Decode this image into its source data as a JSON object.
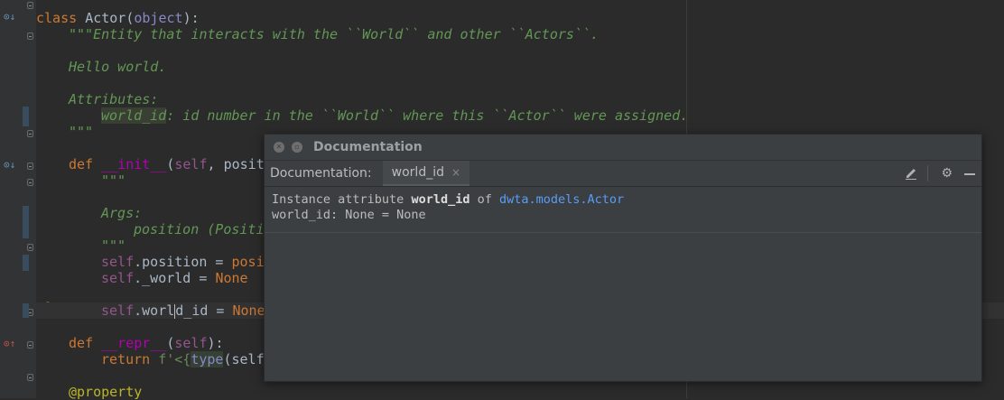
{
  "code": {
    "l1": {
      "kw": "class ",
      "name": "Actor(",
      "base": "object",
      "rest": "):"
    },
    "l2": "\"\"\"Entity that interacts with the ``World`` and other ``Actors``.",
    "l3": "Hello world.",
    "l4": "Attributes:",
    "l5": {
      "attr": "world_id",
      "rest": ": id number in the ``World`` where this ``Actor`` were assigned."
    },
    "l6": "\"\"\"",
    "l7": {
      "kw": "def ",
      "fn": "__init__",
      "rest1": "(",
      "self": "self",
      "rest2": ", posit"
    },
    "l8": "\"\"\"",
    "l9": "Args:",
    "l10": "position (Positi",
    "l11": "\"\"\"",
    "l12": {
      "self": "self",
      "rest": ".position = ",
      "val": "posi"
    },
    "l13": {
      "self": "self",
      "rest": "._world = ",
      "val": "None"
    },
    "l14": {
      "self": "self",
      "rest_a": ".worl",
      "rest_b": "d_id = ",
      "val": "None"
    },
    "l15": {
      "kw": "def ",
      "fn": "__repr__",
      "rest1": "(",
      "self": "self",
      "rest2": "):"
    },
    "l16": {
      "kw": "return ",
      "str": "f'<{",
      "builtin": "type",
      "rest": "(self"
    },
    "l17": "@property"
  },
  "popup": {
    "title": "Documentation",
    "tabs_label": "Documentation:",
    "tab": "world_id",
    "tab_close": "×",
    "icons": [
      "edit-icon",
      "gear-icon",
      "minimize-icon"
    ],
    "line1_pre": "Instance attribute ",
    "line1_bold": "world_id",
    "line1_mid": " of ",
    "line1_link": "dwta.models.Actor",
    "line2": "world_id: None = None"
  }
}
